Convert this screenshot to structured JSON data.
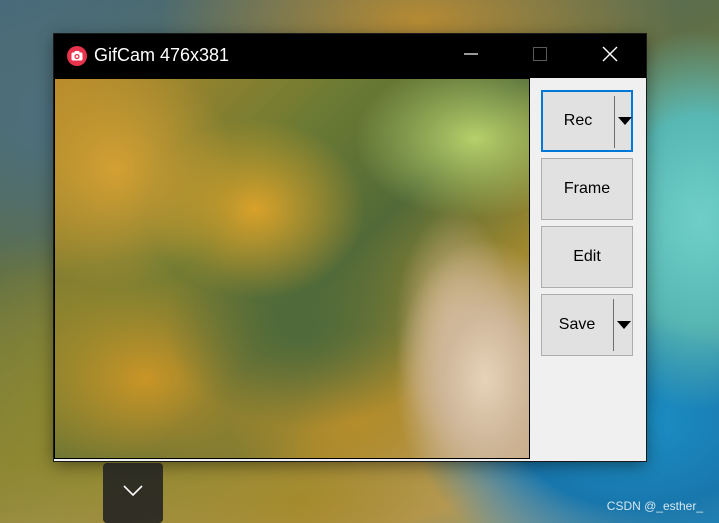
{
  "window": {
    "title": "GifCam 476x381",
    "app_icon": "camera-icon",
    "accent_color": "#e8334d",
    "caption_buttons": {
      "minimize": "minimize-icon",
      "maximize": "maximize-icon",
      "close": "close-icon"
    }
  },
  "panel": {
    "rec_label": "Rec",
    "frame_label": "Frame",
    "edit_label": "Edit",
    "save_label": "Save",
    "dropdown_icon": "triangle-down-icon",
    "focus_color": "#0078d7"
  },
  "flyout": {
    "icon": "chevron-down-icon"
  },
  "watermark": {
    "text": "CSDN @_esther_"
  }
}
